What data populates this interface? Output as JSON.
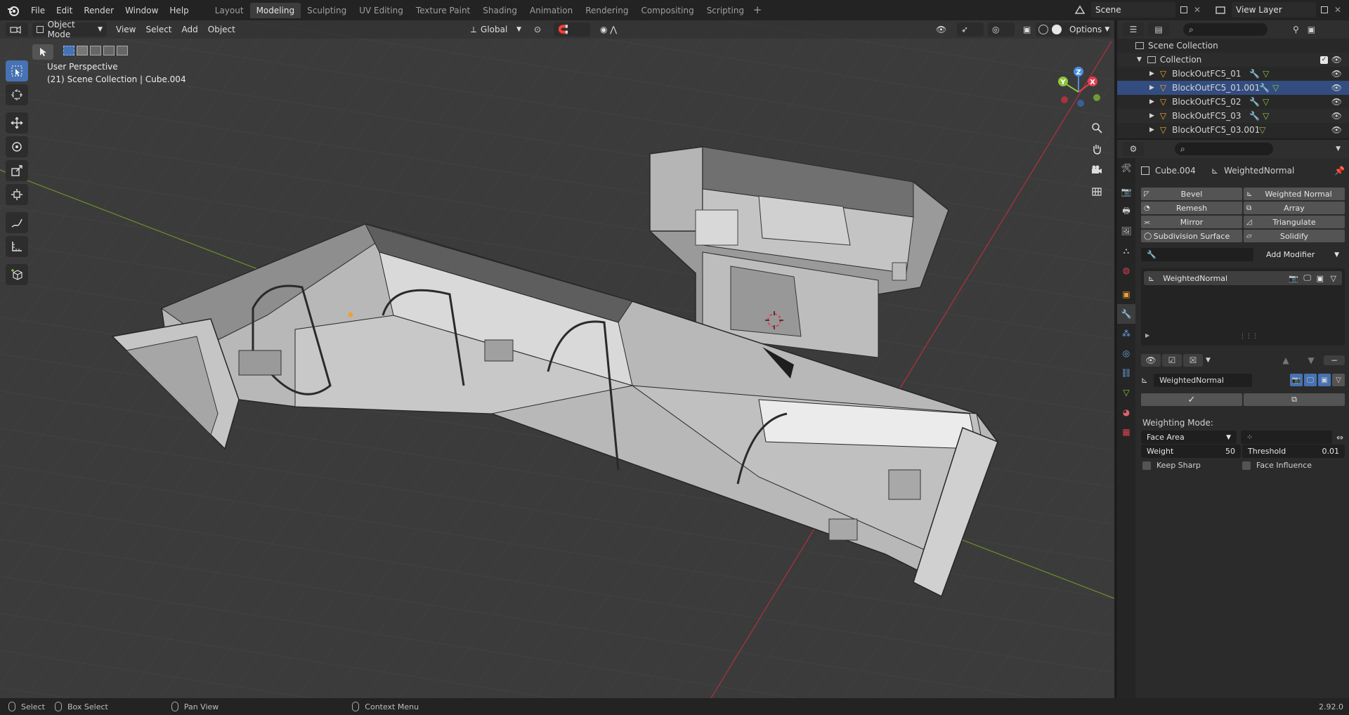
{
  "topbar": {
    "menus": [
      "File",
      "Edit",
      "Render",
      "Window",
      "Help"
    ],
    "workspaces": [
      "Layout",
      "Modeling",
      "Sculpting",
      "UV Editing",
      "Texture Paint",
      "Shading",
      "Animation",
      "Rendering",
      "Compositing",
      "Scripting"
    ],
    "active_workspace": "Modeling",
    "scene": "Scene",
    "view_layer": "View Layer"
  },
  "viewport": {
    "mode": "Object Mode",
    "menus": [
      "View",
      "Select",
      "Add",
      "Object"
    ],
    "transform_orientation": "Global",
    "options_label": "Options",
    "info_line1": "User Perspective",
    "info_line2": "(21) Scene Collection | Cube.004",
    "gizmo_x": "X",
    "gizmo_y": "Y",
    "gizmo_z": "Z"
  },
  "outliner": {
    "scene_collection": "Scene Collection",
    "collection": "Collection",
    "items": [
      "BlockOutFC5_01",
      "BlockOutFC5_01.001",
      "BlockOutFC5_02",
      "BlockOutFC5_03",
      "BlockOutFC5_03.001"
    ],
    "selected_index": 1
  },
  "properties": {
    "object_name": "Cube.004",
    "modifier_breadcrumb": "WeightedNormal",
    "recent_modifiers": [
      "Bevel",
      "Weighted Normal",
      "Remesh",
      "Array",
      "Mirror",
      "Triangulate",
      "Subdivision Surface",
      "Solidify"
    ],
    "add_modifier_label": "Add Modifier",
    "stack_item": "WeightedNormal",
    "modifier_name": "WeightedNormal",
    "weighting_mode_label": "Weighting Mode:",
    "weighting_mode": "Face Area",
    "weight_label": "Weight",
    "weight_value": "50",
    "threshold_label": "Threshold",
    "threshold_value": "0.01",
    "keep_sharp_label": "Keep Sharp",
    "face_influence_label": "Face Influence"
  },
  "statusbar": {
    "select": "Select",
    "box_select": "Box Select",
    "pan_view": "Pan View",
    "context_menu": "Context Menu",
    "version": "2.92.0"
  },
  "colors": {
    "accent_blue": "#4772b3",
    "axis_x": "#e04050",
    "axis_y": "#8cc63f",
    "axis_z": "#4a8fe0",
    "viewport_bg": "#3b3b3b",
    "selected_row": "#334d80"
  }
}
